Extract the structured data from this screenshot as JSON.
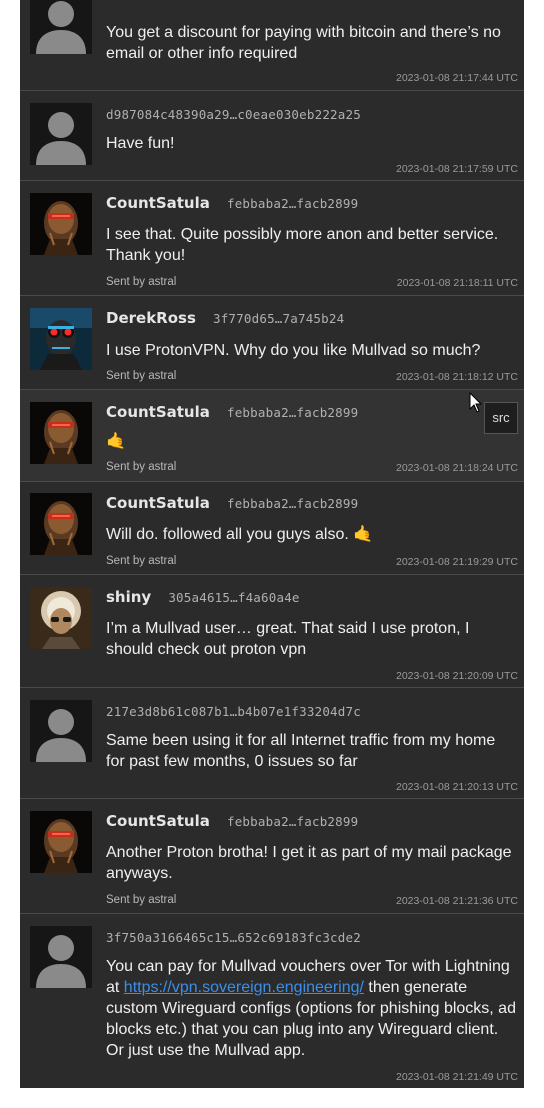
{
  "messages": [
    {
      "avatar": "default-avatar",
      "name": "",
      "pubkey": "",
      "text": "You get a discount for paying with bitcoin and there’s no email or other info required",
      "sent_by": "",
      "timestamp": "2023-01-08 21:17:44 UTC"
    },
    {
      "avatar": "default-avatar",
      "name": "",
      "pubkey": "d987084c48390a29…c0eae030eb222a25",
      "text": "Have fun!",
      "sent_by": "",
      "timestamp": "2023-01-08 21:17:59 UTC"
    },
    {
      "avatar": "countsatula-avatar",
      "name": "CountSatula",
      "pubkey": "febbaba2…facb2899",
      "text": "I see that. Quite possibly more anon and better service. Thank you!",
      "sent_by": "Sent by astral",
      "timestamp": "2023-01-08 21:18:11 UTC"
    },
    {
      "avatar": "derekross-avatar",
      "name": "DerekRoss",
      "pubkey": "3f770d65…7a745b24",
      "text": "I use ProtonVPN. Why do you like Mullvad so much?",
      "sent_by": "Sent by astral",
      "timestamp": "2023-01-08 21:18:12 UTC"
    },
    {
      "avatar": "countsatula-avatar",
      "name": "CountSatula",
      "pubkey": "febbaba2…facb2899",
      "text": "🤙",
      "sent_by": "Sent by astral",
      "timestamp": "2023-01-08 21:18:24 UTC"
    },
    {
      "avatar": "countsatula-avatar",
      "name": "CountSatula",
      "pubkey": "febbaba2…facb2899",
      "text": "Will do. followed all you guys also. 🤙",
      "sent_by": "Sent by astral",
      "timestamp": "2023-01-08 21:19:29 UTC"
    },
    {
      "avatar": "shiny-avatar",
      "name": "shiny",
      "pubkey": "305a4615…f4a60a4e",
      "text": "I’m a Mullvad user… great. That said I use proton, I should check out proton vpn",
      "sent_by": "",
      "timestamp": "2023-01-08 21:20:09 UTC"
    },
    {
      "avatar": "default-avatar",
      "name": "",
      "pubkey": "217e3d8b61c087b1…b4b07e1f33204d7c",
      "text": "Same been using it for all Internet traffic from my home for past few months, 0 issues so far",
      "sent_by": "",
      "timestamp": "2023-01-08 21:20:13 UTC"
    },
    {
      "avatar": "countsatula-avatar",
      "name": "CountSatula",
      "pubkey": "febbaba2…facb2899",
      "text": "Another Proton brotha! I get it as part of my mail package anyways.",
      "sent_by": "Sent by astral",
      "timestamp": "2023-01-08 21:21:36 UTC"
    },
    {
      "avatar": "default-avatar",
      "name": "",
      "pubkey": "3f750a3166465c15…652c69183fc3cde2",
      "text_before": "You can pay for Mullvad vouchers over Tor with Lightning at ",
      "link": "https://vpn.sovereign.engineering/",
      "text_after": " then generate custom Wireguard configs (options for phishing blocks, ad blocks etc.) that you can plug into any Wireguard client. Or just use the Mullvad app.",
      "sent_by": "",
      "timestamp": "2023-01-08 21:21:49 UTC"
    }
  ],
  "tooltip": "src",
  "colors": {
    "background": "#2b2b2b",
    "hover_background": "#333333",
    "link": "#3b8eea",
    "divider": "#4a4a4a"
  }
}
